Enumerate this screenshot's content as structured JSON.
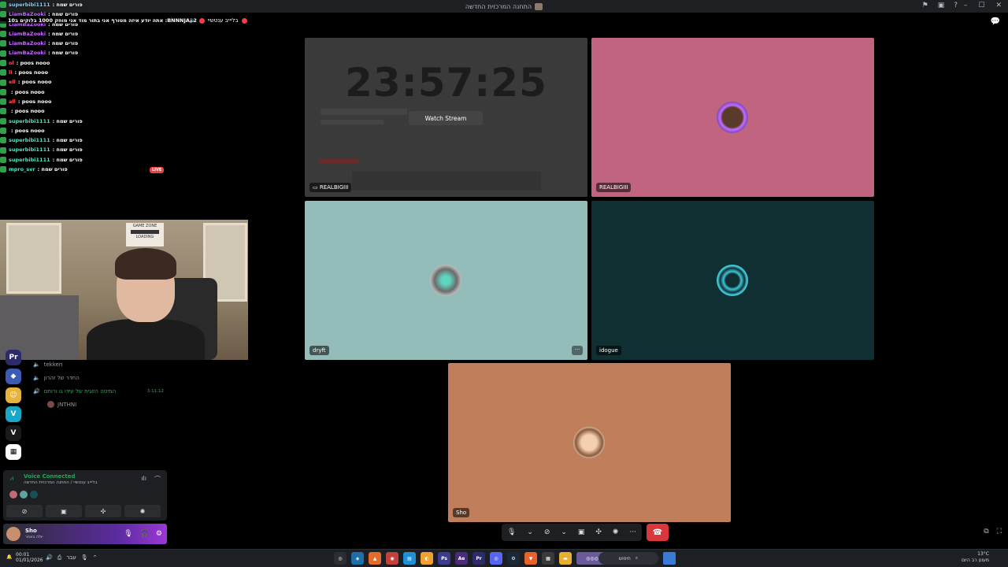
{
  "titlebar": {
    "title": "התחנה המרכזית החדשה"
  },
  "overlay": {
    "banner": "אתה יודע איזה מטורף אני בתור מוד אני מוחק 1000 בלוקים ב10 :BNNNJA12",
    "channel_name": "בליייב ענטשיי",
    "live_label": "LIVE"
  },
  "chat": [
    {
      "user": "superbibi1111",
      "msg": ": פורים שמח",
      "color": ""
    },
    {
      "user": "LiamBaZooki",
      "msg": ": פורים שמח",
      "color": "p"
    },
    {
      "user": "LiamBaZooki",
      "msg": ": פורים שמח",
      "color": "p"
    },
    {
      "user": "LiamBaZooki",
      "msg": ": פורים שמח",
      "color": "p"
    },
    {
      "user": "LiamBaZooki",
      "msg": ": פורים שמח",
      "color": "p"
    },
    {
      "user": "LiamBaZooki",
      "msg": ": פורים שמח",
      "color": "p"
    },
    {
      "user": "ol",
      "msg": ": poos nooo",
      "color": "r"
    },
    {
      "user": "ll",
      "msg": ": poos nooo",
      "color": "r"
    },
    {
      "user": "ell",
      "msg": ": poos nooo",
      "color": "r"
    },
    {
      "user": "",
      "msg": ": poos nooo",
      "color": "r"
    },
    {
      "user": "all",
      "msg": ": poos nooo",
      "color": "r"
    },
    {
      "user": "",
      "msg": ": poos nooo",
      "color": "r"
    },
    {
      "user": "superbibi1111",
      "msg": ": פורים שמח",
      "color": "g"
    },
    {
      "user": "",
      "msg": ": poos nooo",
      "color": "r"
    },
    {
      "user": "superbibi1111",
      "msg": ": פורים שמח",
      "color": "g"
    },
    {
      "user": "superbibi1111",
      "msg": ": פורים שמח",
      "color": "g"
    },
    {
      "user": "superbibi1111",
      "msg": ": פורים שמח",
      "color": "g"
    },
    {
      "user": "mpro_svr",
      "msg": ": פורים שמח",
      "color": "g"
    }
  ],
  "webcam": {
    "poster_line1": "GAME ZONE",
    "poster_line2": "LOADING"
  },
  "channels": [
    {
      "name": "tekken",
      "kind": "voice",
      "timer": ""
    },
    {
      "name": "החדר של זהרון",
      "kind": "voice",
      "timer": ""
    },
    {
      "name": "המיטה הזוגית של עידו גו ורותם",
      "kind": "voice-active",
      "timer": "3:11:12"
    },
    {
      "name": "JNTHNI",
      "kind": "member",
      "timer": ""
    }
  ],
  "voice_panel": {
    "title": "Voice Connected",
    "subtitle": "בליייב ענטשיי / התחנה המרכזית החדשה"
  },
  "user_panel": {
    "name": "Sho",
    "status": "יולה באתר"
  },
  "tiles": {
    "stream": {
      "clock": "23:57:25",
      "watch_label": "Watch Stream",
      "name": "REALBIGIII"
    },
    "realbig": {
      "name": "REALBIGIII"
    },
    "dryft": {
      "name": "dryft"
    },
    "idogue": {
      "name": "idogue"
    },
    "sho": {
      "name": "Sho"
    }
  },
  "taskbar": {
    "time": "00:01",
    "date": "01/01/2026",
    "lang": "עבר",
    "search": "חיפוש",
    "weather_temp": "13°C",
    "weather_desc": "מעונן רב היום"
  },
  "colors": {
    "stream": "#3a3a3a",
    "realbig": "#c0647f",
    "dryft": "#94bcb8",
    "idogue": "#0f2f32",
    "sho": "#c07e5b",
    "hangup": "#da373c"
  }
}
